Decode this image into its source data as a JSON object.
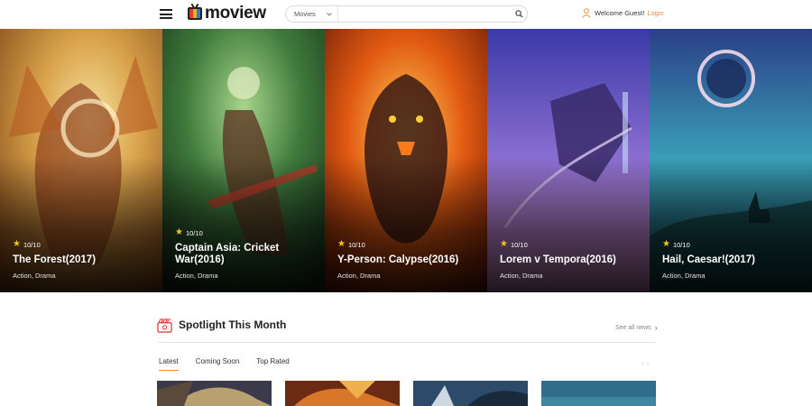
{
  "header": {
    "logo_text": "moview",
    "search": {
      "category": "Movies",
      "placeholder": ""
    },
    "account": {
      "welcome": "Welcome Guest!",
      "login": "Login"
    }
  },
  "hero": {
    "slides": [
      {
        "rating": "10/10",
        "title": "The Forest(2017)",
        "genre": "Action, Drama"
      },
      {
        "rating": "10/10",
        "title": "Captain Asia: Cricket War(2016)",
        "genre": "Action, Drama"
      },
      {
        "rating": "10/10",
        "title": "Y-Person: Calypse(2016)",
        "genre": "Action, Drama"
      },
      {
        "rating": "10/10",
        "title": "Lorem v Tempora(2016)",
        "genre": "Action, Drama"
      },
      {
        "rating": "10/10",
        "title": "Hail, Caesar!(2017)",
        "genre": "Action, Drama"
      }
    ]
  },
  "spotlight": {
    "title": "Spotlight This Month",
    "see_all": "See all news",
    "tabs": [
      "Latest",
      "Coming Soon",
      "Top Rated"
    ],
    "active_tab": "Latest"
  },
  "colors": {
    "accent": "#f5893b",
    "star": "#f5c518"
  }
}
